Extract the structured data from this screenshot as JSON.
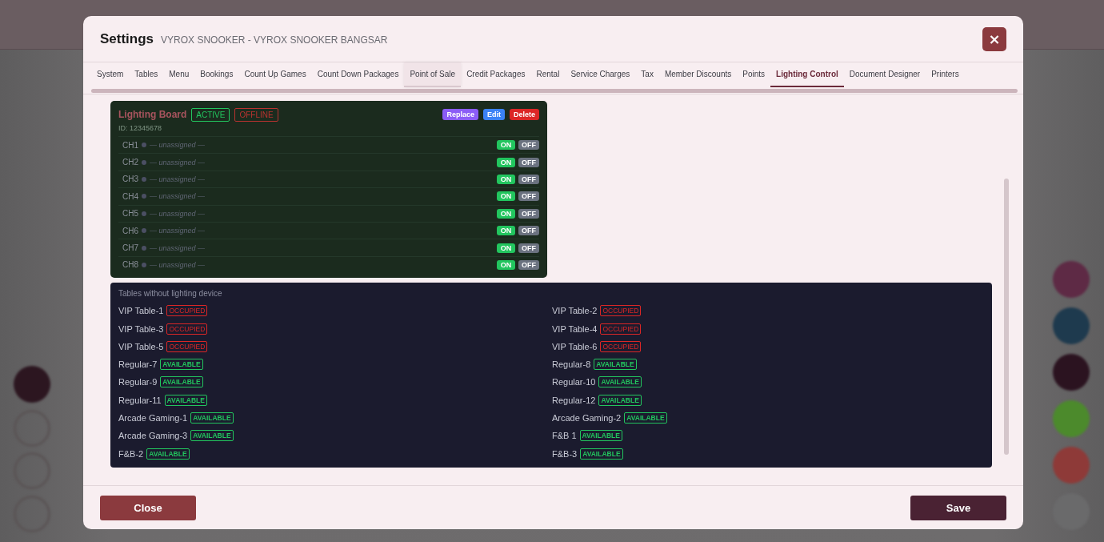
{
  "dialog": {
    "title": "Settings",
    "subtitle": "VYROX SNOOKER - VYROX SNOOKER BANGSAR",
    "close_icon": "×"
  },
  "tabs": [
    {
      "label": "System",
      "selected": false,
      "hovered": false
    },
    {
      "label": "Tables",
      "selected": false,
      "hovered": false
    },
    {
      "label": "Menu",
      "selected": false,
      "hovered": false
    },
    {
      "label": "Bookings",
      "selected": false,
      "hovered": false
    },
    {
      "label": "Count Up Games",
      "selected": false,
      "hovered": false
    },
    {
      "label": "Count Down Packages",
      "selected": false,
      "hovered": false
    },
    {
      "label": "Point of Sale",
      "selected": false,
      "hovered": true
    },
    {
      "label": "Credit Packages",
      "selected": false,
      "hovered": false
    },
    {
      "label": "Rental",
      "selected": false,
      "hovered": false
    },
    {
      "label": "Service Charges",
      "selected": false,
      "hovered": false
    },
    {
      "label": "Tax",
      "selected": false,
      "hovered": false
    },
    {
      "label": "Member Discounts",
      "selected": false,
      "hovered": false
    },
    {
      "label": "Points",
      "selected": false,
      "hovered": false
    },
    {
      "label": "Lighting Control",
      "selected": true,
      "hovered": false
    },
    {
      "label": "Document Designer",
      "selected": false,
      "hovered": false
    },
    {
      "label": "Printers",
      "selected": false,
      "hovered": false
    }
  ],
  "board": {
    "title": "Lighting Board",
    "badges": [
      {
        "label": "ACTIVE",
        "kind": "good"
      },
      {
        "label": "OFFLINE",
        "kind": "bad"
      }
    ],
    "buttons": [
      {
        "label": "Replace",
        "kind": "replace"
      },
      {
        "label": "Edit",
        "kind": "edit"
      },
      {
        "label": "Delete",
        "kind": "delete"
      }
    ],
    "id": "ID: 12345678",
    "channels": [
      {
        "name": "CH1",
        "assignment": "— unassigned —",
        "on": "ON",
        "off": "OFF"
      },
      {
        "name": "CH2",
        "assignment": "— unassigned —",
        "on": "ON",
        "off": "OFF"
      },
      {
        "name": "CH3",
        "assignment": "— unassigned —",
        "on": "ON",
        "off": "OFF"
      },
      {
        "name": "CH4",
        "assignment": "— unassigned —",
        "on": "ON",
        "off": "OFF"
      },
      {
        "name": "CH5",
        "assignment": "— unassigned —",
        "on": "ON",
        "off": "OFF"
      },
      {
        "name": "CH6",
        "assignment": "— unassigned —",
        "on": "ON",
        "off": "OFF"
      },
      {
        "name": "CH7",
        "assignment": "— unassigned —",
        "on": "ON",
        "off": "OFF"
      },
      {
        "name": "CH8",
        "assignment": "— unassigned —",
        "on": "ON",
        "off": "OFF"
      }
    ]
  },
  "unlinked_tables": {
    "title": "Tables without lighting device",
    "tables": [
      {
        "name": "VIP Table-1",
        "status": "OCCUPIED",
        "kind": "occupied"
      },
      {
        "name": "VIP Table-2",
        "status": "OCCUPIED",
        "kind": "occupied"
      },
      {
        "name": "VIP Table-3",
        "status": "OCCUPIED",
        "kind": "occupied"
      },
      {
        "name": "VIP Table-4",
        "status": "OCCUPIED",
        "kind": "occupied"
      },
      {
        "name": "VIP Table-5",
        "status": "OCCUPIED",
        "kind": "occupied"
      },
      {
        "name": "VIP Table-6",
        "status": "OCCUPIED",
        "kind": "occupied"
      },
      {
        "name": "Regular-7",
        "status": "AVAILABLE",
        "kind": "available"
      },
      {
        "name": "Regular-8",
        "status": "AVAILABLE",
        "kind": "available"
      },
      {
        "name": "Regular-9",
        "status": "AVAILABLE",
        "kind": "available"
      },
      {
        "name": "Regular-10",
        "status": "AVAILABLE",
        "kind": "available"
      },
      {
        "name": "Regular-11",
        "status": "AVAILABLE",
        "kind": "available"
      },
      {
        "name": "Regular-12",
        "status": "AVAILABLE",
        "kind": "available"
      },
      {
        "name": "Arcade Gaming-1",
        "status": "AVAILABLE",
        "kind": "available"
      },
      {
        "name": "Arcade Gaming-2",
        "status": "AVAILABLE",
        "kind": "available"
      },
      {
        "name": "Arcade Gaming-3",
        "status": "AVAILABLE",
        "kind": "available"
      },
      {
        "name": "F&B 1",
        "status": "AVAILABLE",
        "kind": "available"
      },
      {
        "name": "F&B-2",
        "status": "AVAILABLE",
        "kind": "available"
      },
      {
        "name": "F&B-3",
        "status": "AVAILABLE",
        "kind": "available"
      }
    ]
  },
  "footer": {
    "close": "Close",
    "save": "Save"
  }
}
